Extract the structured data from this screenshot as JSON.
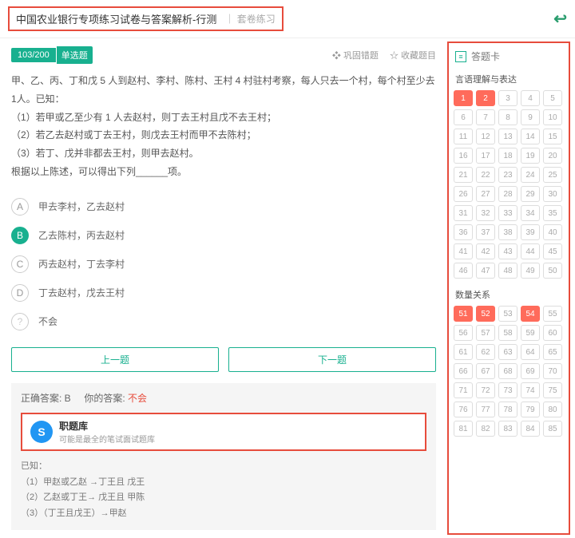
{
  "header": {
    "title": "中国农业银行专项练习试卷与答案解析-行测",
    "subtitle": "套卷练习"
  },
  "question": {
    "index": "103/200",
    "type": "单选题",
    "action_consolidate": "巩固错题",
    "action_favorite": "收藏题目",
    "stem": "甲、乙、丙、丁和戊 5 人到赵村、李村、陈村、王村 4 村驻村考察，每人只去一个村，每个村至少去 1人。已知：\n（1）若甲或乙至少有 1 人去赵村，则丁去王村且戊不去王村；\n（2）若乙去赵村或丁去王村，则戊去王村而甲不去陈村；\n（3）若丁、戊并非都去王村，则甲去赵村。\n根据以上陈述，可以得出下列______项。",
    "options": [
      {
        "letter": "A",
        "text": "甲去李村，乙去赵村"
      },
      {
        "letter": "B",
        "text": "乙去陈村，丙去赵村"
      },
      {
        "letter": "C",
        "text": "丙去赵村，丁去李村"
      },
      {
        "letter": "D",
        "text": "丁去赵村，戊去王村"
      },
      {
        "letter": "?",
        "text": "不会"
      }
    ],
    "selected": "B"
  },
  "nav": {
    "prev": "上一题",
    "next": "下一题"
  },
  "answer": {
    "correct_label": "正确答案: B",
    "your_label": "你的答案:",
    "your_value": "不会",
    "lib_title": "职题库",
    "lib_sub": "可能是最全的笔试面试题库",
    "explain_head": "已知：",
    "explain_lines": [
      "（1）甲赵或乙赵 →丁王且 戊王",
      "（2）乙赵或丁王→ 戊王且 甲陈",
      "（3）（丁王且戊王）→甲赵"
    ]
  },
  "card": {
    "title": "答题卡",
    "section1": "言语理解与表达",
    "section2": "数量关系",
    "s1_active": [
      1,
      2
    ],
    "s2_active": [
      51,
      52,
      54
    ]
  }
}
